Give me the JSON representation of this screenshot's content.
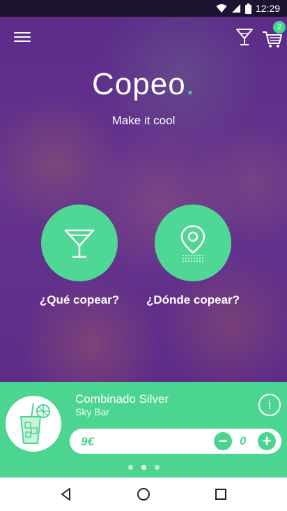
{
  "statusbar": {
    "time": "12:29"
  },
  "header": {
    "cart_count": "2"
  },
  "brand": {
    "name": "Copeo",
    "dot": ".",
    "tagline": "Make it cool"
  },
  "actions": [
    {
      "label": "¿Qué copear?",
      "icon": "cocktail-glass-icon"
    },
    {
      "label": "¿Dónde copear?",
      "icon": "map-pin-icon"
    }
  ],
  "promo": {
    "title": "Combinado Silver",
    "venue": "Sky Bar",
    "price": "9€",
    "quantity": "0",
    "minus": "−",
    "plus": "+",
    "info": "i",
    "carousel_total": 3,
    "carousel_active": 2
  },
  "colors": {
    "accent": "#4cd590",
    "overlay": "#5a2e86"
  }
}
